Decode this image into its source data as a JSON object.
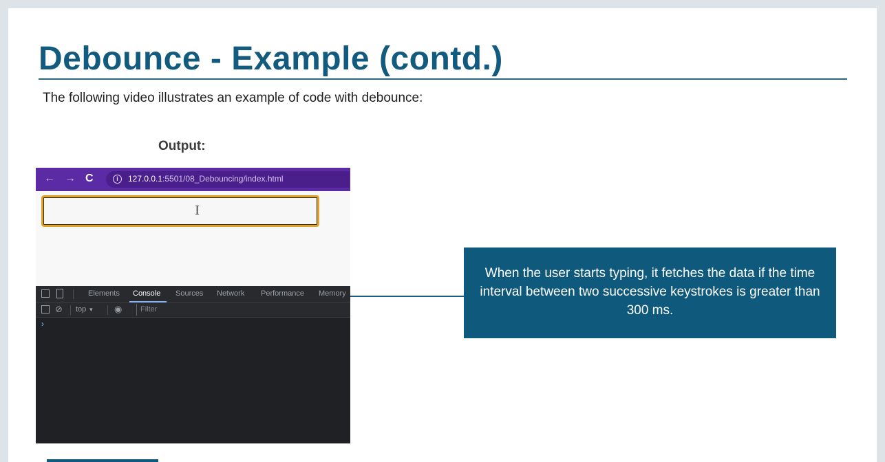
{
  "slide": {
    "title": "Debounce - Example (contd.)",
    "intro": "The following video illustrates an example of code with debounce:",
    "output_label": "Output:",
    "callout": "When the user starts typing, it fetches the data if the time interval between two successive keystrokes is greater than 300 ms."
  },
  "browser": {
    "back_icon": "arrow-left-icon",
    "forward_icon": "arrow-right-icon",
    "reload_icon": "reload-icon",
    "url_host": "127.0.0.1",
    "url_rest": ":5501/08_Debouncing/index.html"
  },
  "devtools": {
    "tabs": [
      "Elements",
      "Console",
      "Sources",
      "Network",
      "Performance",
      "Memory"
    ],
    "active_tab": "Console",
    "context": "top",
    "context_arrow": "▼",
    "filter_placeholder": "Filter",
    "prompt": "›"
  },
  "colors": {
    "title": "#135b7e",
    "callout_bg": "#0f5a7c",
    "browser_bar": "#5b2aa5",
    "input_border": "#e4a222"
  }
}
